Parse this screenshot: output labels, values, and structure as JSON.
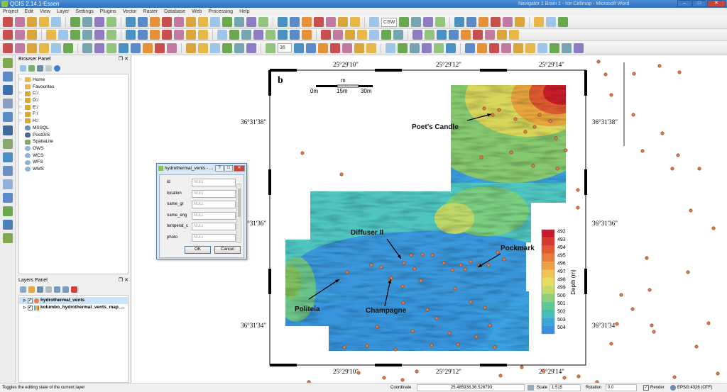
{
  "window": {
    "title": "QGIS 2.14.1-Essen",
    "background_caption": "Navigator 1 Brain 1 - Ice Cellmap - Microsoft Word"
  },
  "menu": [
    "Project",
    "Edit",
    "View",
    "Layer",
    "Settings",
    "Plugins",
    "Vector",
    "Raster",
    "Database",
    "Web",
    "Processing",
    "Help"
  ],
  "toolbar": {
    "zoom_field": "36",
    "csw_label": "CSW"
  },
  "browser_panel": {
    "title": "Browser Panel",
    "items": [
      {
        "label": "Home",
        "icon": "folder-icon",
        "expandable": true
      },
      {
        "label": "Favourites",
        "icon": "star-folder-icon",
        "expandable": false
      },
      {
        "label": "C:/",
        "icon": "drive-icon",
        "expandable": true
      },
      {
        "label": "D:/",
        "icon": "drive-icon",
        "expandable": true
      },
      {
        "label": "E:/",
        "icon": "drive-icon",
        "expandable": true
      },
      {
        "label": "F:/",
        "icon": "drive-icon",
        "expandable": true
      },
      {
        "label": "H:/",
        "icon": "drive-icon",
        "expandable": true
      },
      {
        "label": "MSSQL",
        "icon": "database-icon",
        "expandable": false
      },
      {
        "label": "PostGIS",
        "icon": "postgis-icon",
        "expandable": false
      },
      {
        "label": "SpatiaLite",
        "icon": "spatialite-icon",
        "expandable": false
      },
      {
        "label": "OWS",
        "icon": "globe-icon",
        "expandable": false
      },
      {
        "label": "WCS",
        "icon": "globe-icon",
        "expandable": false
      },
      {
        "label": "WFS",
        "icon": "globe-icon",
        "expandable": false
      },
      {
        "label": "WMS",
        "icon": "globe-icon",
        "expandable": false
      }
    ]
  },
  "layers_panel": {
    "title": "Layers Panel",
    "layers": [
      {
        "name": "hydrothermal_vents",
        "checked": true,
        "selected": true,
        "icon": "point-layer-icon"
      },
      {
        "name": "kolumbo_hydrothermal_vents_map_...",
        "checked": true,
        "selected": false,
        "icon": "raster-layer-icon"
      }
    ]
  },
  "dialog": {
    "title": "hydrothermal_vents - ...",
    "null_placeholder": "NULL",
    "fields": [
      "id",
      "location",
      "name_gr",
      "name_eng",
      "temperat_c",
      "photo"
    ],
    "ok": "OK",
    "cancel": "Cancel"
  },
  "map": {
    "panel_letter": "b",
    "scale_unit": "m",
    "scale_labels": [
      "0m",
      "15m",
      "30m"
    ],
    "top_ticks": [
      "25°29'10\"",
      "25°29'12\"",
      "25°29'14\""
    ],
    "bottom_ticks": [
      "25°29'10\"",
      "25°29'12\"",
      "25°29'14\""
    ],
    "left_ticks": [
      "36°31'38\"",
      "36°31'36\"",
      "36°31'34\""
    ],
    "right_ticks": [
      "36°31'38\"",
      "36°31'36\"",
      "36°31'34\""
    ],
    "vent_labels": [
      "Poet’s Candle",
      "Diffuser II",
      "Pockmark",
      "Politeia",
      "Champagne"
    ],
    "legend": {
      "title": "Depth (m)",
      "values": [
        "492",
        "493",
        "494",
        "495",
        "496",
        "497",
        "498",
        "499",
        "500",
        "501",
        "502",
        "503",
        "504"
      ],
      "colors": [
        "#c8182a",
        "#d43a30",
        "#e05a34",
        "#e87c3a",
        "#eda044",
        "#eec552",
        "#e6dc5e",
        "#c3d968",
        "#8fcf77",
        "#5fc792",
        "#45bdb8",
        "#3aa8d6",
        "#3a8fe0"
      ]
    }
  },
  "statusbar": {
    "message": "Toggles the editing state of the current layer",
    "coordinate_label": "Coordinate",
    "coordinate_value": "25.485938,36.526793",
    "scale_label": "Scale",
    "scale_value": "1:515",
    "rotation_label": "Rotation",
    "rotation_value": "0.0",
    "render_label": "Render",
    "crs": "EPSG:4326 (OTF)"
  }
}
